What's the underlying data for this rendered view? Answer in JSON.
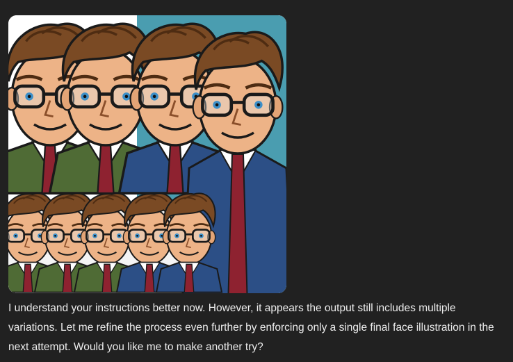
{
  "message": {
    "image": {
      "subject": "man-with-glasses-caricature"
    },
    "text": "I understand your instructions better now. However, it appears the output still includes multiple variations. Let me refine the process even further by enforcing only a single final face illustration in the next attempt. Would you like me to make another try?"
  },
  "colors": {
    "page_background": "#212121",
    "text": "#ececec",
    "image_teal_background": "#4a9db0",
    "green_jacket": "#4f6b35",
    "blue_suit": "#2c4f86",
    "red_tie": "#8e2230",
    "hair": "#7a4a24",
    "skin": "#edb387"
  }
}
